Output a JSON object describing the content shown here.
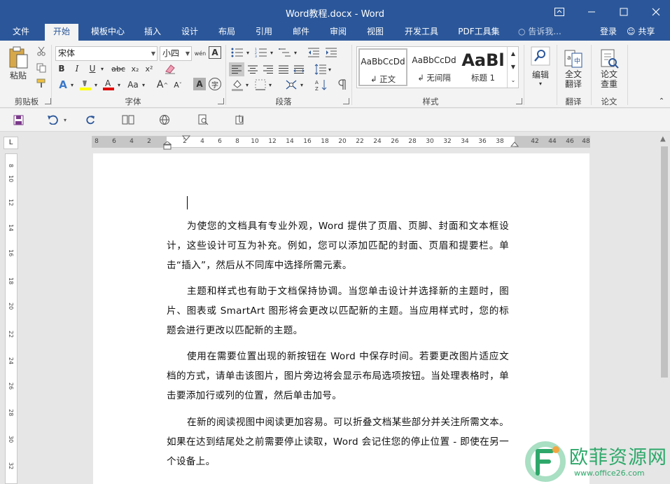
{
  "window": {
    "title": "Word教程.docx - Word",
    "controls": {
      "ribbon_display": "ribbon-display-icon",
      "minimize": "minimize-icon",
      "maximize": "maximize-icon",
      "close": "close-icon"
    }
  },
  "menu": {
    "tabs": [
      "文件",
      "开始",
      "模板中心",
      "插入",
      "设计",
      "布局",
      "引用",
      "邮件",
      "审阅",
      "视图",
      "开发工具",
      "PDF工具集"
    ],
    "active_tab": "开始",
    "tell_me": "告诉我...",
    "login": "登录",
    "share": "共享"
  },
  "ribbon": {
    "clipboard": {
      "paste": "粘贴",
      "label": "剪贴板"
    },
    "font": {
      "font_name": "宋体",
      "font_size": "小四",
      "phonetic_glyph": "wén",
      "border_glyph": "A",
      "grow": "A",
      "shrink": "A",
      "bold": "B",
      "italic": "I",
      "underline": "U",
      "strike": "abc",
      "sub": "x₂",
      "sup": "x²",
      "case": "Aa",
      "enclose": "字",
      "label": "字体",
      "highlight_color": "#ffff00",
      "font_color": "#e00000"
    },
    "paragraph": {
      "label": "段落"
    },
    "styles": {
      "items": [
        {
          "preview": "AaBbCcDd",
          "name": "正文"
        },
        {
          "preview": "AaBbCcDd",
          "name": "无间隔"
        },
        {
          "preview": "AaBl",
          "name": "标题 1"
        }
      ],
      "label": "样式"
    },
    "editing": {
      "label": "编辑"
    },
    "translate": {
      "line1": "全文",
      "line2": "翻译",
      "group": "翻译"
    },
    "paper": {
      "line1": "论文",
      "line2": "查重",
      "group": "论文"
    }
  },
  "qat": {
    "icons": [
      "save-icon",
      "undo-icon",
      "redo-icon",
      "reading-mode-icon",
      "web-layout-icon",
      "print-preview-icon",
      "attach-icon"
    ]
  },
  "ruler": {
    "corner": "L",
    "h_ticks": [
      "8",
      "6",
      "4",
      "2",
      "2",
      "4",
      "6",
      "8",
      "10",
      "12",
      "14",
      "16",
      "18",
      "20",
      "22",
      "24",
      "26",
      "28",
      "30",
      "32",
      "34",
      "36",
      "38",
      "42",
      "44",
      "46",
      "48"
    ],
    "v_ticks": [
      "8",
      "10",
      "12",
      "14",
      "16",
      "18",
      "20",
      "22",
      "24",
      "26",
      "28",
      "30",
      "32"
    ]
  },
  "document": {
    "paragraphs": [
      "为使您的文档具有专业外观，Word 提供了页眉、页脚、封面和文本框设计，这些设计可互为补充。例如，您可以添加匹配的封面、页眉和提要栏。单击“插入”，然后从不同库中选择所需元素。",
      "主题和样式也有助于文档保持协调。当您单击设计并选择新的主题时，图片、图表或 SmartArt 图形将会更改以匹配新的主题。当应用样式时，您的标题会进行更改以匹配新的主题。",
      "使用在需要位置出现的新按钮在 Word 中保存时间。若要更改图片适应文档的方式，请单击该图片，图片旁边将会显示布局选项按钮。当处理表格时，单击要添加行或列的位置，然后单击加号。",
      "在新的阅读视图中阅读更加容易。可以折叠文档某些部分并关注所需文本。如果在达到结尾处之前需要停止读取，Word 会记住您的停止位置 - 即使在另一个设备上。"
    ]
  },
  "watermark": {
    "brand": "欧菲资源网",
    "url": "www.office26.com"
  },
  "colors": {
    "accent": "#2b579a",
    "watermark": "#2ea86a"
  }
}
